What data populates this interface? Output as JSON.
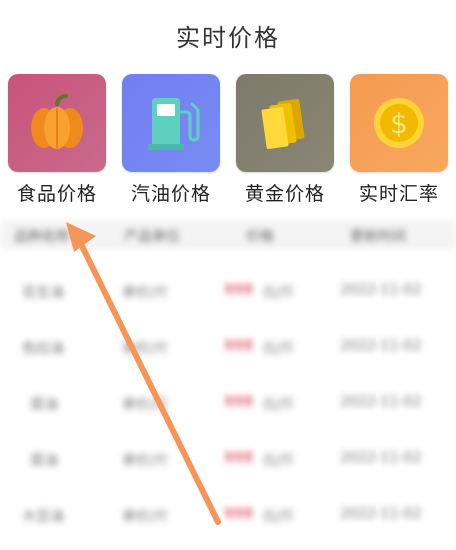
{
  "header": {
    "title": "实时价格"
  },
  "categories": [
    {
      "label": "食品价格",
      "icon": "pumpkin-icon",
      "color_from": "#c8547a",
      "color_to": "#c86a8c"
    },
    {
      "label": "汽油价格",
      "icon": "gas-pump-icon",
      "color_from": "#6f7ff0",
      "color_to": "#7a8bf5"
    },
    {
      "label": "黄金价格",
      "icon": "gold-bars-icon",
      "color_from": "#7d7a6a",
      "color_to": "#8a8676"
    },
    {
      "label": "实时汇率",
      "icon": "dollar-coin-icon",
      "color_from": "#f59a50",
      "color_to": "#f8a860"
    }
  ],
  "table": {
    "headers": [
      "品种名称",
      "产品单位",
      "价格",
      "更新时间"
    ],
    "rows": [
      {
        "name": "花生油",
        "unit": "单价/斤",
        "price": "998",
        "unit2": "元/斤",
        "time": "2022-11-02"
      },
      {
        "name": "色拉油",
        "unit": "单价/斤",
        "price": "998",
        "unit2": "元/斤",
        "time": "2022-11-02"
      },
      {
        "name": "菜油",
        "unit": "单价/斤",
        "price": "998",
        "unit2": "元/斤",
        "time": "2022-11-02"
      },
      {
        "name": "菜油",
        "unit": "单价/斤",
        "price": "998",
        "unit2": "元/斤",
        "time": "2022-11-02"
      },
      {
        "name": "大豆油",
        "unit": "单价/斤",
        "price": "998",
        "unit2": "元/斤",
        "time": "2022-11-02"
      }
    ]
  },
  "annotation": {
    "arrow_color": "#f5955a"
  }
}
